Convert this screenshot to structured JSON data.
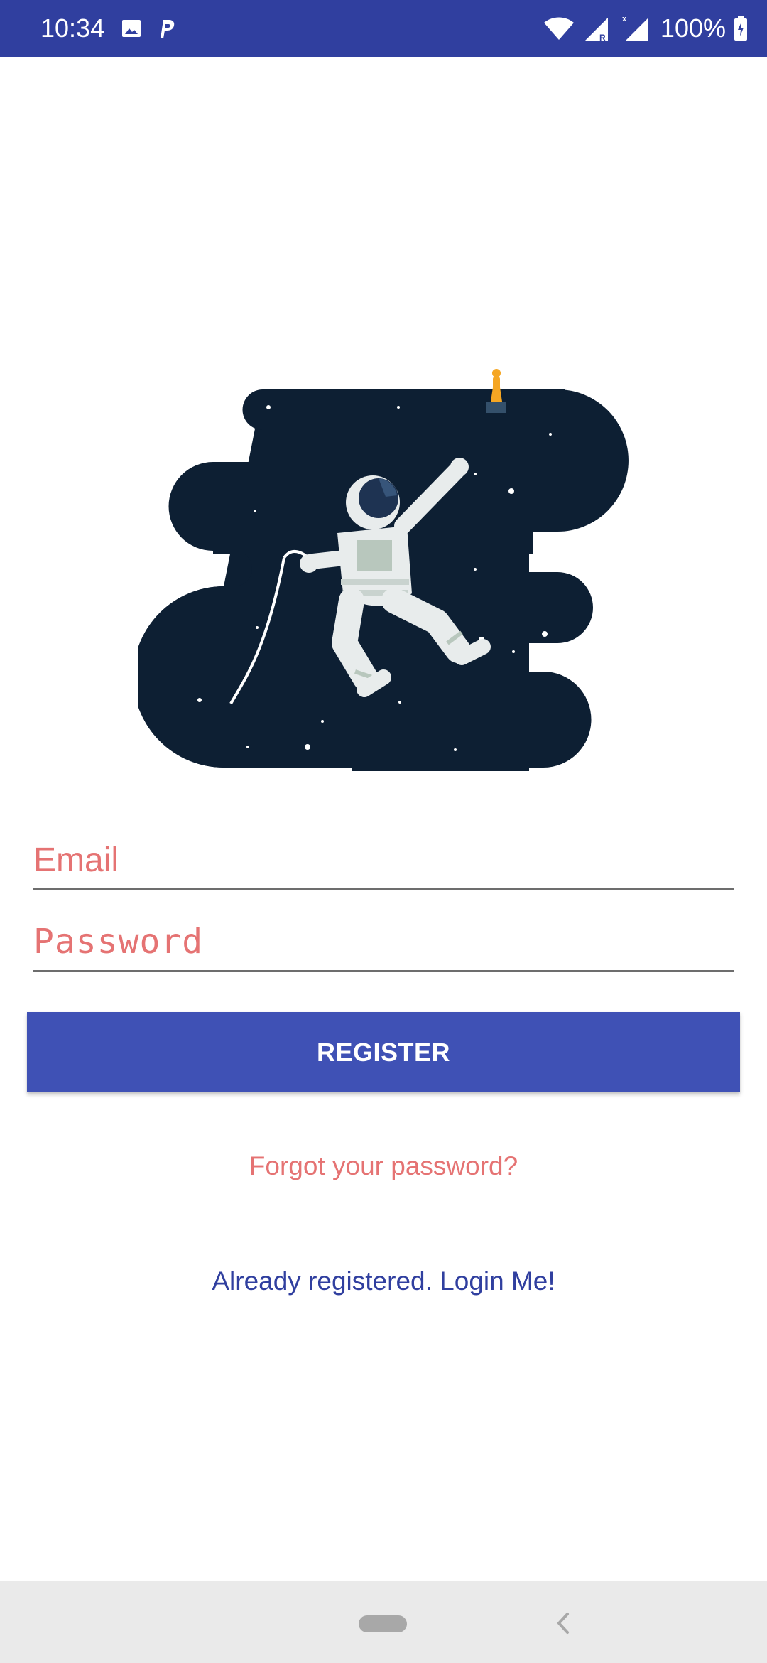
{
  "status_bar": {
    "time": "10:34",
    "battery_percent": "100%",
    "background": "#303f9f",
    "left_icons": [
      "image-icon",
      "p-app-icon"
    ],
    "right_icons": [
      "wifi-icon",
      "signal-roaming-icon",
      "signal-icon",
      "battery-charging-icon"
    ]
  },
  "illustration": {
    "subject": "astronaut-in-space",
    "colors": {
      "space": "#0d1f33",
      "suit": "#e8ecec",
      "trophy": "#f5a623"
    }
  },
  "form": {
    "email_placeholder": "Email",
    "email_value": "",
    "password_placeholder": "Password",
    "password_value": "",
    "register_label": "REGISTER",
    "forgot_label": "Forgot your password?",
    "login_label": "Already registered. Login Me!"
  },
  "colors": {
    "primary": "#3f51b5",
    "primary_dark": "#303f9f",
    "accent": "#e57373"
  },
  "nav_bar": {
    "icons": [
      "home-pill-icon",
      "back-chevron-icon"
    ]
  }
}
